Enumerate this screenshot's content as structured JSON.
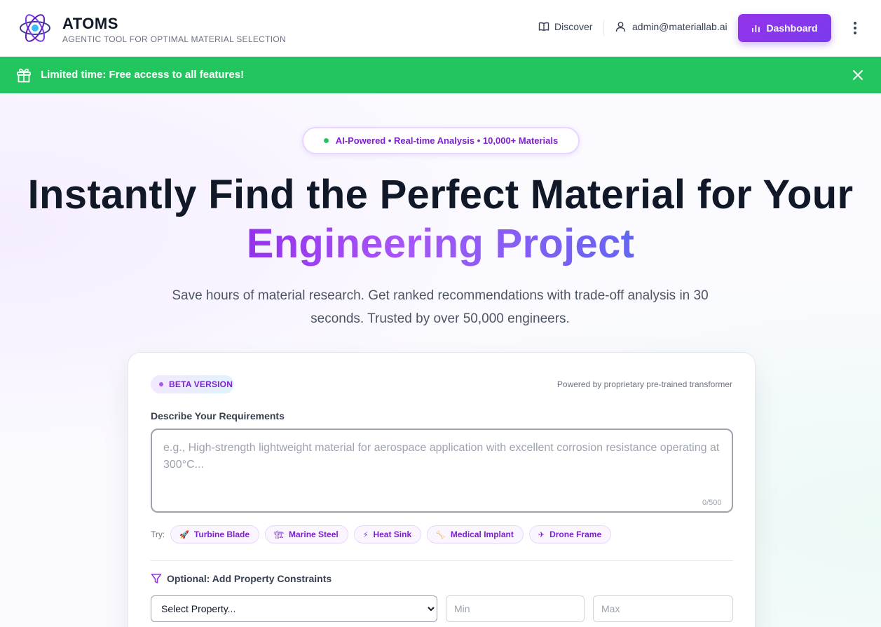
{
  "header": {
    "brand_name": "ATOMS",
    "tagline": "AGENTIC TOOL FOR OPTIMAL MATERIAL SELECTION",
    "discover_label": "Discover",
    "user_email": "admin@materiallab.ai",
    "dashboard_label": "Dashboard"
  },
  "promo": {
    "text": "Limited time: Free access to all features!",
    "color": "#22c55e"
  },
  "hero": {
    "pill_text": "AI-Powered • Real-time Analysis • 10,000+ Materials",
    "headline_line1": "Instantly Find the Perfect Material for Your",
    "headline_line2": "Engineering Project",
    "subtitle": "Save hours of material research. Get ranked recommendations with trade-off analysis in 30 seconds. Trusted by over 50,000 engineers."
  },
  "card": {
    "beta_label": "BETA VERSION",
    "powered_by": "Powered by proprietary pre-trained transformer",
    "requirements_label": "Describe Your Requirements",
    "requirements_placeholder": "e.g., High-strength lightweight material for aerospace application with excellent corrosion resistance operating at 300°C...",
    "requirements_value": "",
    "char_count": "0/500",
    "try_label": "Try:",
    "suggestions": [
      {
        "icon": "rocket-icon",
        "glyph": "🚀",
        "label": "Turbine Blade"
      },
      {
        "icon": "crane-icon",
        "glyph": "🏗",
        "label": "Marine Steel"
      },
      {
        "icon": "lightning-icon",
        "glyph": "⚡",
        "label": "Heat Sink"
      },
      {
        "icon": "bone-icon",
        "glyph": "🦴",
        "label": "Medical Implant"
      },
      {
        "icon": "airplane-icon",
        "glyph": "✈",
        "label": "Drone Frame"
      }
    ],
    "constraints_label": "Optional: Add Property Constraints",
    "property_select": {
      "selected": "Select Property..."
    },
    "min_placeholder": "Min",
    "max_placeholder": "Max"
  },
  "colors": {
    "accent": "#9333ea",
    "accent_dark": "#7e22ce",
    "success": "#22c55e",
    "text": "#111827"
  }
}
